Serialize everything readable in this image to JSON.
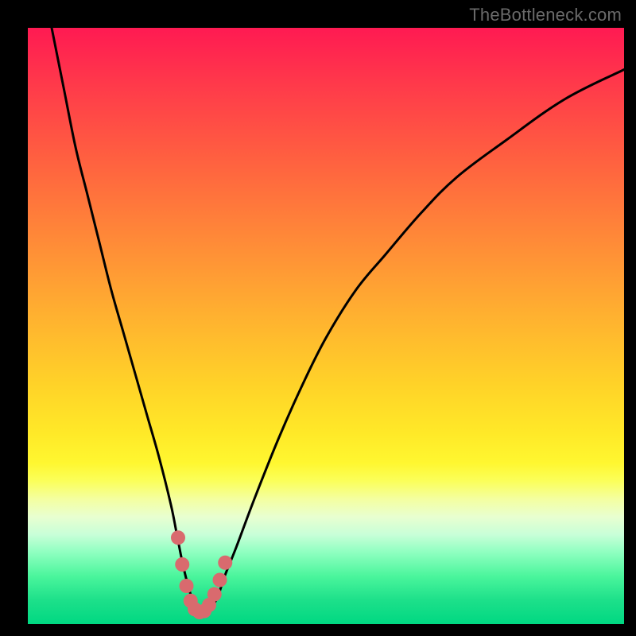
{
  "watermark": "TheBottleneck.com",
  "colors": {
    "frame": "#000000",
    "curve": "#000000",
    "marker": "#d96a6e",
    "marker_stroke": "#d96a6e"
  },
  "chart_data": {
    "type": "line",
    "title": "",
    "xlabel": "",
    "ylabel": "",
    "xlim": [
      0,
      100
    ],
    "ylim": [
      0,
      100
    ],
    "grid": false,
    "legend": false,
    "series": [
      {
        "name": "bottleneck-curve",
        "x": [
          4,
          6,
          8,
          10,
          12,
          14,
          16,
          18,
          20,
          22,
          24,
          25,
          26,
          27,
          28,
          29,
          30,
          31,
          32,
          33,
          35,
          38,
          42,
          46,
          50,
          55,
          60,
          66,
          72,
          80,
          90,
          100
        ],
        "y": [
          100,
          90,
          80,
          72,
          64,
          56,
          49,
          42,
          35,
          28,
          20,
          15,
          10,
          6,
          3,
          2,
          2,
          3,
          5,
          8,
          13,
          21,
          31,
          40,
          48,
          56,
          62,
          69,
          75,
          81,
          88,
          93
        ]
      }
    ],
    "markers": {
      "name": "minimum-region",
      "x": [
        25.2,
        25.9,
        26.6,
        27.3,
        28.0,
        28.8,
        29.6,
        30.4,
        31.3,
        32.2,
        33.1
      ],
      "y": [
        14.5,
        10.0,
        6.4,
        3.9,
        2.5,
        2.0,
        2.2,
        3.2,
        5.0,
        7.4,
        10.3
      ]
    }
  }
}
